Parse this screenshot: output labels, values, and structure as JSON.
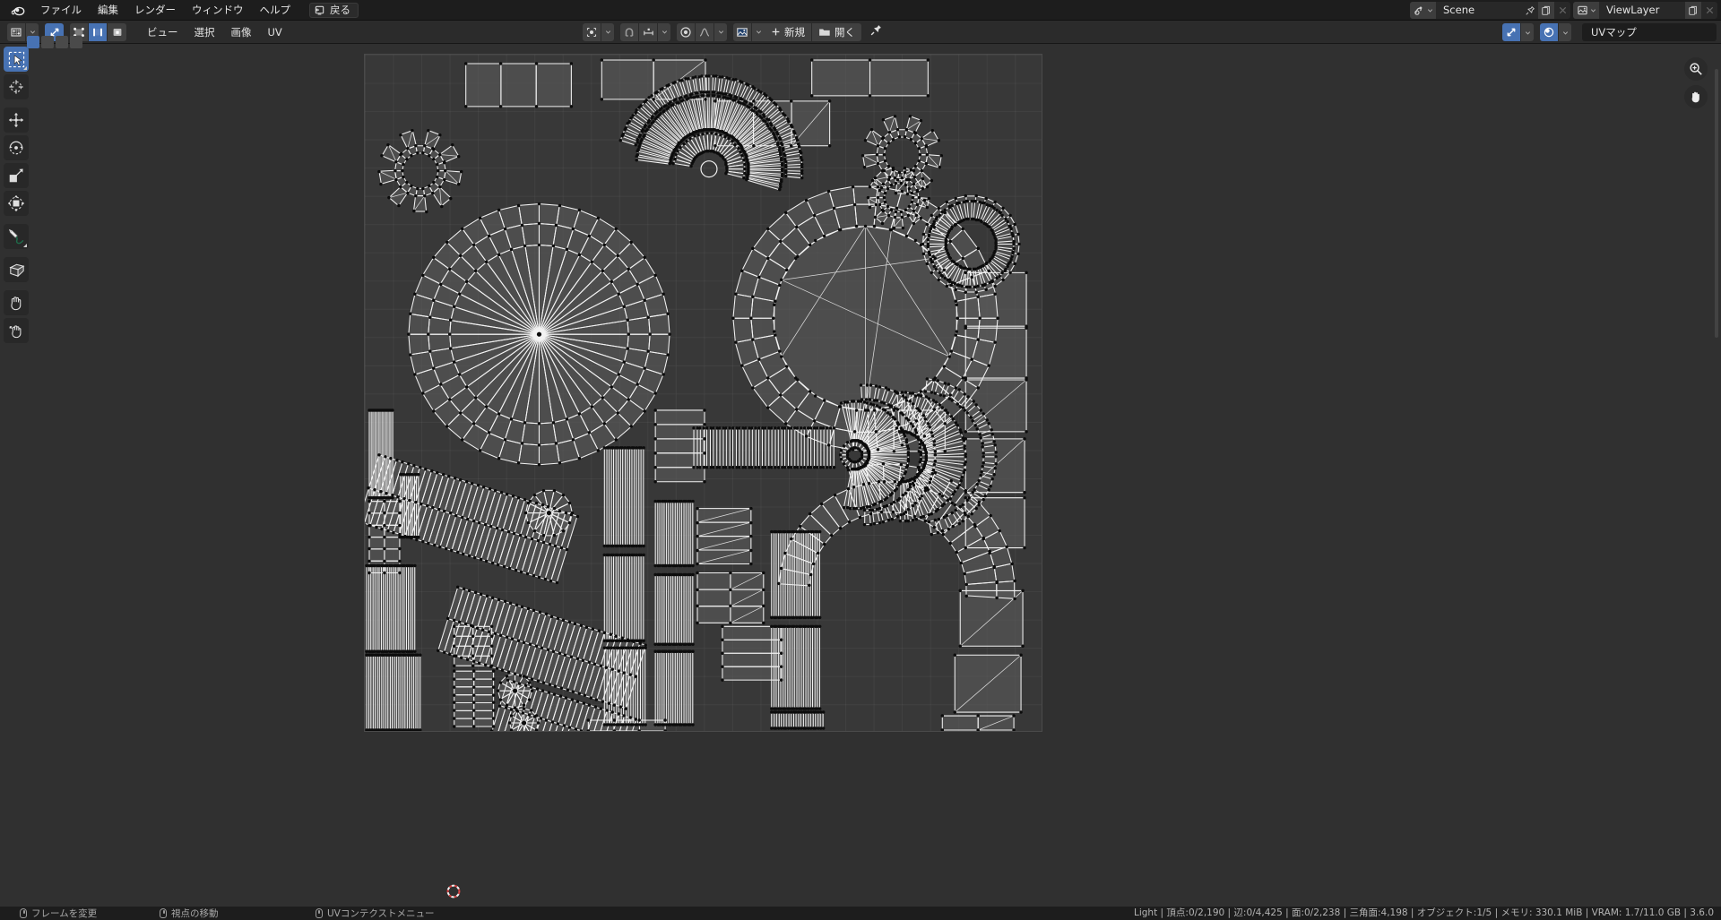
{
  "app": {
    "name": "Blender",
    "theme_bg": "#303030",
    "accent": "#4772b3",
    "header_bg": "#2b2b2b",
    "topbar_bg": "#1d1d1d"
  },
  "topbar": {
    "logo_icon": "blender-logo-icon",
    "menus": [
      {
        "label": "ファイル",
        "name": "menu-file"
      },
      {
        "label": "編集",
        "name": "menu-edit"
      },
      {
        "label": "レンダー",
        "name": "menu-render"
      },
      {
        "label": "ウィンドウ",
        "name": "menu-window"
      },
      {
        "label": "ヘルプ",
        "name": "menu-help"
      }
    ],
    "back_button": {
      "label": "戻る",
      "icon": "back-to-previous-icon"
    },
    "scene": {
      "icon": "scene-icon",
      "value": "Scene",
      "pin_icon": "pin-icon",
      "new_icon": "new-copy-icon",
      "unlink_icon": "unlink-x-icon"
    },
    "view_layer": {
      "icon": "view-layer-icon",
      "value": "ViewLayer",
      "new_icon": "new-copy-icon",
      "unlink_icon": "unlink-x-icon"
    }
  },
  "editor_header": {
    "editor_type": {
      "icon": "uv-editor-icon",
      "label": "UV Editor"
    },
    "uv_sync_selection": {
      "icon": "uv-sync-icon",
      "active": true
    },
    "select_modes": [
      {
        "name": "select-mode-vertex",
        "icon": "vertex-select-icon",
        "active": false
      },
      {
        "name": "select-mode-edge",
        "icon": "edge-select-icon",
        "active": true
      },
      {
        "name": "select-mode-face",
        "icon": "face-select-icon",
        "active": false
      }
    ],
    "menus": [
      {
        "label": "ビュー",
        "name": "menu-view"
      },
      {
        "label": "選択",
        "name": "menu-select"
      },
      {
        "label": "画像",
        "name": "menu-image"
      },
      {
        "label": "UV",
        "name": "menu-uv"
      }
    ],
    "pivot": {
      "icon": "pivot-point-icon"
    },
    "snap": {
      "icon": "snap-magnet-icon",
      "target_icon": "snap-increment-icon"
    },
    "proportional": {
      "icon": "proportional-editing-icon",
      "falloff_icon": "smooth-falloff-icon"
    },
    "image_browse": {
      "icon": "image-datablock-icon"
    },
    "new_image": {
      "label": "新規",
      "icon": "plus-icon"
    },
    "open_image": {
      "label": "開く",
      "icon": "folder-open-icon"
    },
    "pin_image": {
      "icon": "pin-icon"
    },
    "display_channels": {
      "icon": "display-channels-icon"
    },
    "overlays": {
      "icon": "overlays-icon",
      "active": true
    },
    "uv_map_name": "UVマップ"
  },
  "select_tool_row": [
    {
      "name": "select-box-mode",
      "icon": "select-box-icon",
      "active": true
    },
    {
      "name": "select-extend-mode",
      "icon": "select-extend-icon",
      "active": false
    },
    {
      "name": "select-subtract-mode",
      "icon": "select-subtract-icon",
      "active": false
    },
    {
      "name": "select-difference-mode",
      "icon": "select-difference-icon",
      "active": false
    }
  ],
  "toolbar": {
    "tools": [
      {
        "name": "tool-tweak-select-box",
        "icon": "select-box-cursor-icon",
        "label": "Tweak / Select Box",
        "active": true
      },
      {
        "name": "tool-cursor",
        "icon": "cursor-2d-icon",
        "label": "Cursor",
        "active": false
      },
      {
        "name": "tool-move",
        "icon": "move-arrows-icon",
        "label": "Move",
        "active": false
      },
      {
        "name": "tool-rotate",
        "icon": "rotate-icon",
        "label": "Rotate",
        "active": false
      },
      {
        "name": "tool-scale",
        "icon": "scale-icon",
        "label": "Scale",
        "active": false
      },
      {
        "name": "tool-transform",
        "icon": "transform-icon",
        "label": "Transform",
        "active": false
      },
      {
        "name": "tool-annotate",
        "icon": "annotate-pencil-icon",
        "label": "Annotate",
        "active": false
      },
      {
        "name": "tool-rip-region",
        "icon": "rip-region-icon",
        "label": "Rip Region",
        "active": false
      },
      {
        "name": "tool-grab",
        "icon": "grab-hand-icon",
        "label": "Grab",
        "active": false
      },
      {
        "name": "tool-relax",
        "icon": "relax-hand-icon",
        "label": "Relax",
        "active": false
      }
    ]
  },
  "viewport": {
    "gizmos": [
      {
        "name": "zoom-gizmo",
        "icon": "magnifier-plus-icon"
      },
      {
        "name": "pan-gizmo",
        "icon": "hand-open-icon"
      }
    ],
    "cursor_2d": {
      "name": "cursor-2d",
      "icon": "cursor-2d-icon"
    },
    "uv_grid": {
      "cells": 24,
      "visible": true
    }
  },
  "statusbar": {
    "keymap": [
      {
        "label": "フレームを変更",
        "icon": "mouse-left-icon",
        "name": "status-change-frame"
      },
      {
        "label": "視点の移動",
        "icon": "mouse-middle-icon",
        "name": "status-move-view"
      },
      {
        "label": "UVコンテクストメニュー",
        "icon": "mouse-right-icon",
        "name": "status-uv-context-menu"
      }
    ],
    "scene_stats": "Light | 頂点:0/2,190 | 辺:0/4,425 | 面:0/2,238 | 三角面:4,198 | オブジェクト:1/5 | メモリ: 330.1 MiB | VRAM: 1.7/11.0 GB | 3.6.0",
    "stats_parts": {
      "active_object": "Light",
      "verts": "頂点:0/2,190",
      "edges": "辺:0/4,425",
      "faces": "面:0/2,238",
      "tris": "三角面:4,198",
      "objects": "オブジェクト:1/5",
      "memory": "メモリ: 330.1 MiB",
      "vram": "VRAM: 1.7/11.0 GB",
      "version": "3.6.0"
    }
  }
}
